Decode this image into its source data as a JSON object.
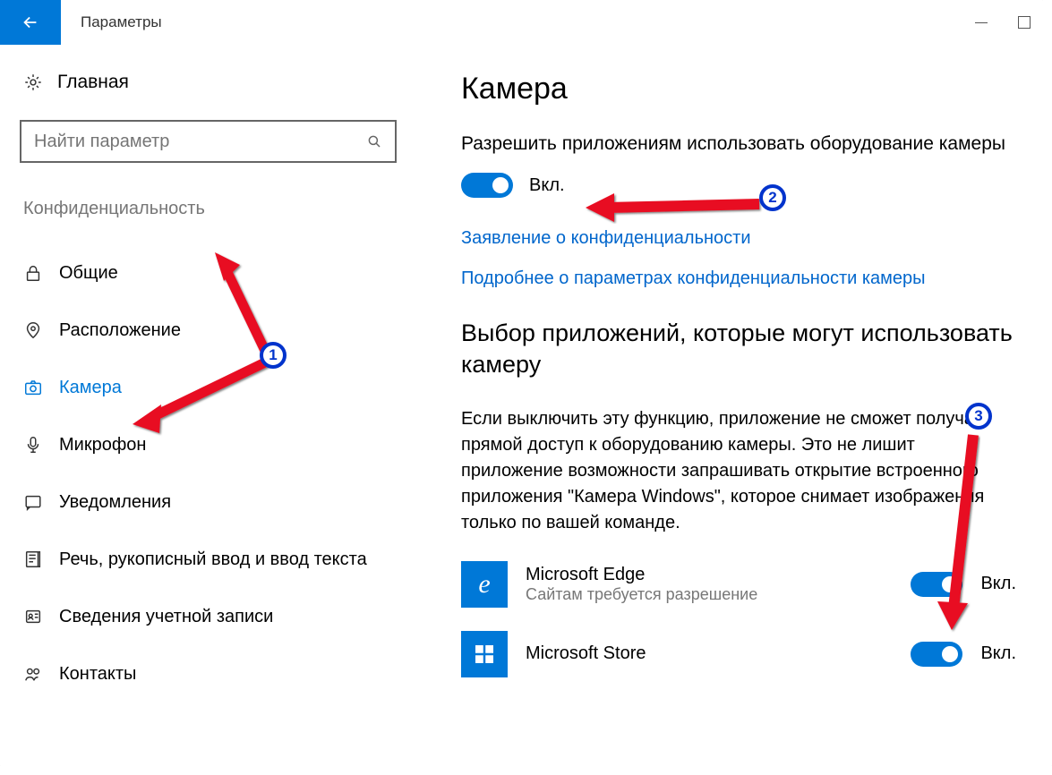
{
  "titlebar": {
    "title": "Параметры"
  },
  "sidebar": {
    "home": "Главная",
    "search_placeholder": "Найти параметр",
    "section": "Конфиденциальность",
    "items": [
      {
        "label": "Общие",
        "icon": "lock"
      },
      {
        "label": "Расположение",
        "icon": "location"
      },
      {
        "label": "Камера",
        "icon": "camera",
        "active": true
      },
      {
        "label": "Микрофон",
        "icon": "mic"
      },
      {
        "label": "Уведомления",
        "icon": "notification"
      },
      {
        "label": "Речь, рукописный ввод и ввод текста",
        "icon": "speech"
      },
      {
        "label": "Сведения учетной записи",
        "icon": "account"
      },
      {
        "label": "Контакты",
        "icon": "contacts"
      }
    ]
  },
  "main": {
    "heading": "Камера",
    "allow_text": "Разрешить приложениям использовать оборудование камеры",
    "toggle_state": "Вкл.",
    "link_privacy": "Заявление о конфиденциальности",
    "link_more": "Подробнее о параметрах конфиденциальности камеры",
    "choose_heading": "Выбор приложений, которые могут использовать камеру",
    "choose_para": "Если выключить эту функцию, приложение не сможет получать прямой доступ к оборудованию камеры. Это не лишит приложение возможности запрашивать открытие встроенного приложения \"Камера Windows\", которое снимает изображения только по вашей команде.",
    "apps": [
      {
        "name": "Microsoft Edge",
        "sub": "Сайтам требуется разрешение",
        "state": "Вкл.",
        "icon": "edge"
      },
      {
        "name": "Microsoft Store",
        "sub": "",
        "state": "Вкл.",
        "icon": "store"
      }
    ]
  },
  "annotations": {
    "badges": [
      "1",
      "2",
      "3"
    ]
  }
}
